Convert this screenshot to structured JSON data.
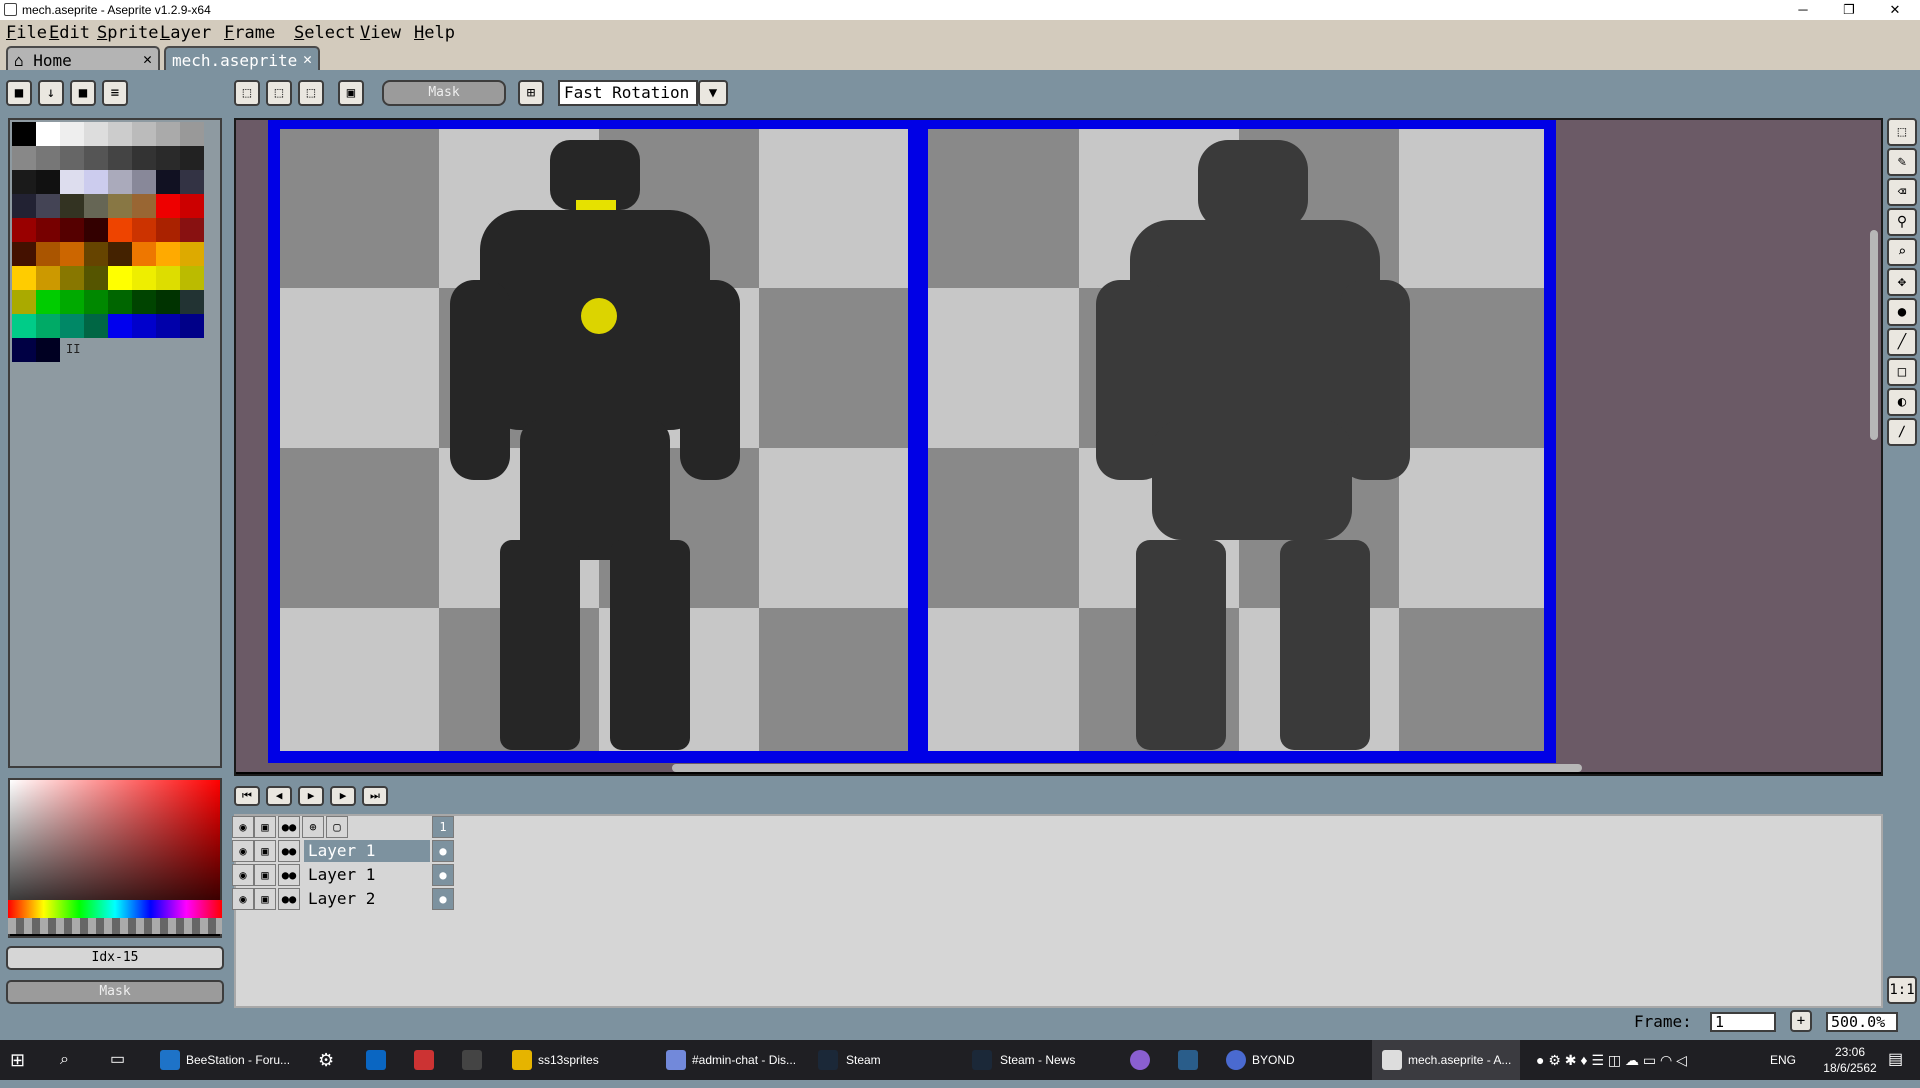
{
  "window": {
    "title": "mech.aseprite - Aseprite v1.2.9-x64",
    "min": "─",
    "max": "❐",
    "close": "✕"
  },
  "menu": [
    "File",
    "Edit",
    "Sprite",
    "Layer",
    "Frame",
    "Select",
    "View",
    "Help"
  ],
  "tabs": [
    {
      "label": "Home",
      "icon": "home-icon",
      "close": "✕"
    },
    {
      "label": "mech.aseprite",
      "close": "✕"
    }
  ],
  "toolbar": {
    "lock_icon": "lock-icon",
    "save_icon": "down-arrow-icon",
    "stop_icon": "square-icon",
    "menu_icon": "hamburger-icon",
    "mask_label": "Mask",
    "rotation_select": "Fast Rotation",
    "dropdown_arrow": "▼"
  },
  "colors": {
    "accent": "#0000e6",
    "canvas_bg": "#6b5a66",
    "chk_light": "#c7c7c7",
    "chk_dark": "#898989"
  },
  "palette": {
    "indicator": "II"
  },
  "color_panel": {
    "index_label": "Idx-15",
    "mask_label": "Mask"
  },
  "timeline": {
    "frame_header": "1",
    "layers": [
      {
        "name": "Layer 1"
      },
      {
        "name": "Layer 1"
      },
      {
        "name": "Layer 2"
      }
    ]
  },
  "statusbar": {
    "frame_label": "Frame:",
    "frame_value": "1",
    "add": "+",
    "zoom": "500.0%",
    "ratio": "1:1"
  },
  "taskbar": {
    "items": [
      "BeeStation - Foru...",
      "ss13sprites",
      "#admin-chat - Dis...",
      "Steam",
      "Steam - News",
      "BYOND",
      "mech.aseprite - A..."
    ],
    "lang": "ENG",
    "time": "23:06",
    "date": "18/6/2562"
  }
}
